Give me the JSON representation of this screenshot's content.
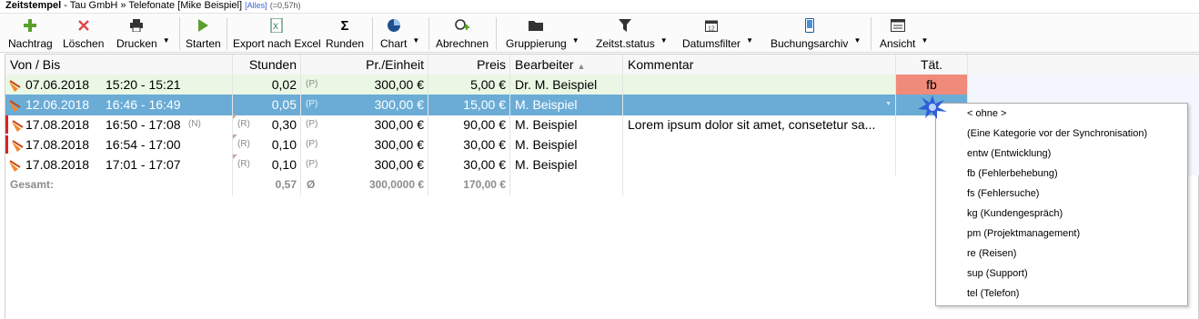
{
  "window": {
    "app": "Zeitstempel",
    "title": " - Tau GmbH » Telefonate [Mike Beispiel]",
    "tag": "[Alles]",
    "sum": "(=0,57h)"
  },
  "toolbar": [
    {
      "label": "Nachtrag",
      "icon": "plus-icon",
      "dropdown": false
    },
    {
      "label": "Löschen",
      "icon": "delete-icon",
      "dropdown": false
    },
    {
      "label": "Drucken",
      "icon": "printer-icon",
      "dropdown": true
    },
    {
      "label": "Starten",
      "icon": "play-icon",
      "dropdown": false
    },
    {
      "label": "Export nach Excel",
      "icon": "excel-icon",
      "dropdown": false
    },
    {
      "label": "Runden",
      "icon": "sigma-icon",
      "dropdown": false
    },
    {
      "label": "Chart",
      "icon": "pie-chart-icon",
      "dropdown": true
    },
    {
      "label": "Abrechnen",
      "icon": "invoice-icon",
      "dropdown": false
    },
    {
      "label": "Gruppierung",
      "icon": "folder-icon",
      "dropdown": true
    },
    {
      "label": "Zeitst.status",
      "icon": "filter-icon",
      "dropdown": true
    },
    {
      "label": "Datumsfilter",
      "icon": "calendar-icon",
      "dropdown": true
    },
    {
      "label": "Buchungsarchiv",
      "icon": "archive-icon",
      "dropdown": true
    },
    {
      "label": "Ansicht",
      "icon": "view-icon",
      "dropdown": true
    }
  ],
  "columns": [
    "Von / Bis",
    "Stunden",
    "Pr./Einheit",
    "Preis",
    "Bearbeiter",
    "Kommentar",
    "Tät."
  ],
  "rows": [
    {
      "date": "07.06.2018",
      "time": "15:20 - 15:21",
      "n": "",
      "r": "",
      "hours": "0,02",
      "p": "(P)",
      "unit": "300,00 €",
      "price": "5,00 €",
      "editor": "Dr. M. Beispiel",
      "comment": "",
      "act": "fb"
    },
    {
      "date": "12.06.2018",
      "time": "16:46 - 16:49",
      "n": "",
      "r": "",
      "hours": "0,05",
      "p": "(P)",
      "unit": "300,00 €",
      "price": "15,00 €",
      "editor": "M. Beispiel",
      "comment": "",
      "act": ""
    },
    {
      "date": "17.08.2018",
      "time": "16:50 - 17:08",
      "n": "(N)",
      "r": "(R)",
      "hours": "0,30",
      "p": "(P)",
      "unit": "300,00 €",
      "price": "90,00 €",
      "editor": "M. Beispiel",
      "comment": "Lorem ipsum dolor sit amet, consetetur sa...",
      "act": ""
    },
    {
      "date": "17.08.2018",
      "time": "16:54 - 17:00",
      "n": "",
      "r": "(R)",
      "hours": "0,10",
      "p": "(P)",
      "unit": "300,00 €",
      "price": "30,00 €",
      "editor": "M. Beispiel",
      "comment": "",
      "act": ""
    },
    {
      "date": "17.08.2018",
      "time": "17:01 - 17:07",
      "n": "",
      "r": "(R)",
      "hours": "0,10",
      "p": "(P)",
      "unit": "300,00 €",
      "price": "30,00 €",
      "editor": "M. Beispiel",
      "comment": "",
      "act": ""
    }
  ],
  "total": {
    "label": "Gesamt:",
    "hours": "0,57",
    "avg": "Ø",
    "unit": "300,0000 €",
    "price": "170,00 €"
  },
  "popup": [
    "< ohne >",
    " (Eine Kategorie vor der Synchronisation)",
    "entw (Entwicklung)",
    "fb (Fehlerbehebung)",
    "fs (Fehlersuche)",
    "kg (Kundengespräch)",
    "pm (Projektmanagement)",
    "re (Reisen)",
    "sup (Support)",
    "tel (Telefon)"
  ],
  "colors": {
    "selected": "#6aacd6",
    "green_row": "#eaf7e4",
    "fb_cell": "#f08a7a",
    "accent": "#3a5fcd"
  }
}
